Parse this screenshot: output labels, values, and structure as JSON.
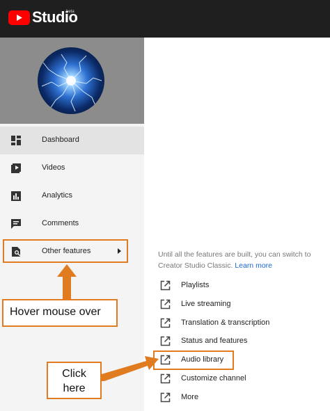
{
  "header": {
    "logo_text": "Studio",
    "logo_beta": "beta",
    "brand_color": "#ff0000"
  },
  "sidebar": {
    "items": [
      {
        "label": "Dashboard",
        "icon": "dashboard-icon",
        "active": true
      },
      {
        "label": "Videos",
        "icon": "videos-icon",
        "active": false
      },
      {
        "label": "Analytics",
        "icon": "analytics-icon",
        "active": false
      },
      {
        "label": "Comments",
        "icon": "comments-icon",
        "active": false
      },
      {
        "label": "Other features",
        "icon": "other-features-icon",
        "active": false,
        "has_submenu": true
      }
    ]
  },
  "submenu": {
    "info_text": "Until all the features are built, you can switch to Creator Studio Classic.",
    "learn_more": "Learn more",
    "items": [
      {
        "label": "Playlists",
        "icon": "external-link-icon"
      },
      {
        "label": "Live streaming",
        "icon": "external-link-icon"
      },
      {
        "label": "Translation & transcription",
        "icon": "external-link-icon"
      },
      {
        "label": "Status and features",
        "icon": "external-link-icon"
      },
      {
        "label": "Audio library",
        "icon": "external-link-icon",
        "highlighted": true
      },
      {
        "label": "Customize channel",
        "icon": "external-link-icon"
      },
      {
        "label": "More",
        "icon": "external-link-icon"
      }
    ]
  },
  "annotations": {
    "hover_text": "Hover mouse over",
    "click_line1": "Click",
    "click_line2": "here",
    "accent_color": "#e07b20"
  }
}
